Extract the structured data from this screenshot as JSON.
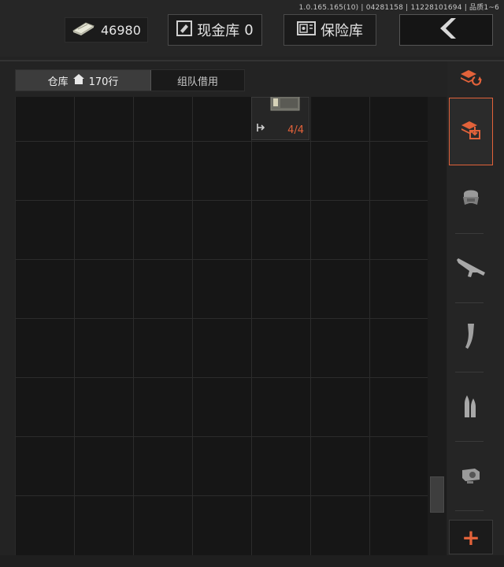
{
  "version_info": "1.0.165.165(10) | 04281158 | 11228101694 | 品质1~6",
  "header": {
    "money": "46980",
    "cash_vault_label": "现金库",
    "cash_vault_value": "0",
    "safe_label": "保险库"
  },
  "tabs": {
    "warehouse_label": "仓库",
    "warehouse_rows": "170行",
    "team_borrow_label": "组队借用"
  },
  "item": {
    "count": "4/4"
  },
  "sidebar": {
    "categories": [
      "refresh-icon",
      "storage-icon",
      "armor-icon",
      "rifle-icon",
      "magazine-icon",
      "ammo-icon",
      "scope-icon"
    ]
  },
  "add_label": "+",
  "colors": {
    "accent": "#e2623a",
    "background": "#232323",
    "grid": "#161616"
  }
}
